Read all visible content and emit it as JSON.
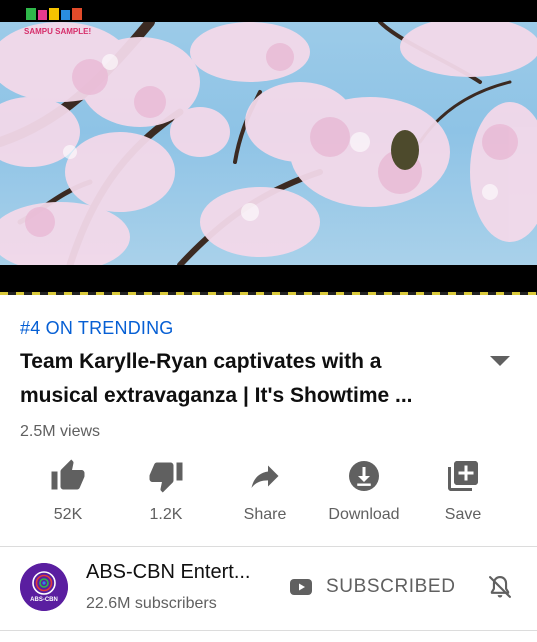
{
  "video": {
    "watermark_text": "SAMPU SAMPLE!"
  },
  "meta": {
    "trending_label": "#4 ON TRENDING",
    "title_line1": "Team Karylle-Ryan captivates with a",
    "title_line2": "musical extravaganza | It's Showtime ...",
    "views": "2.5M views"
  },
  "actions": {
    "like_count": "52K",
    "dislike_count": "1.2K",
    "share_label": "Share",
    "download_label": "Download",
    "save_label": "Save"
  },
  "channel": {
    "name": "ABS-CBN Entert...",
    "subscribers": "22.6M subscribers",
    "subscribe_state": "SUBSCRIBED",
    "avatar_text": "ABS-CBN"
  },
  "icons": {
    "expand": "chevron-down-icon",
    "like": "thumbs-up-icon",
    "dislike": "thumbs-down-icon",
    "share": "share-arrow-icon",
    "download": "download-circle-icon",
    "save": "playlist-add-icon",
    "subscribed": "youtube-logo-icon",
    "notifications": "bell-off-icon"
  },
  "colors": {
    "accent": "#065fd4",
    "text_primary": "#0f0f0f",
    "text_secondary": "#606060",
    "icon": "#606060",
    "avatar_bg": "#5a1ea0"
  }
}
